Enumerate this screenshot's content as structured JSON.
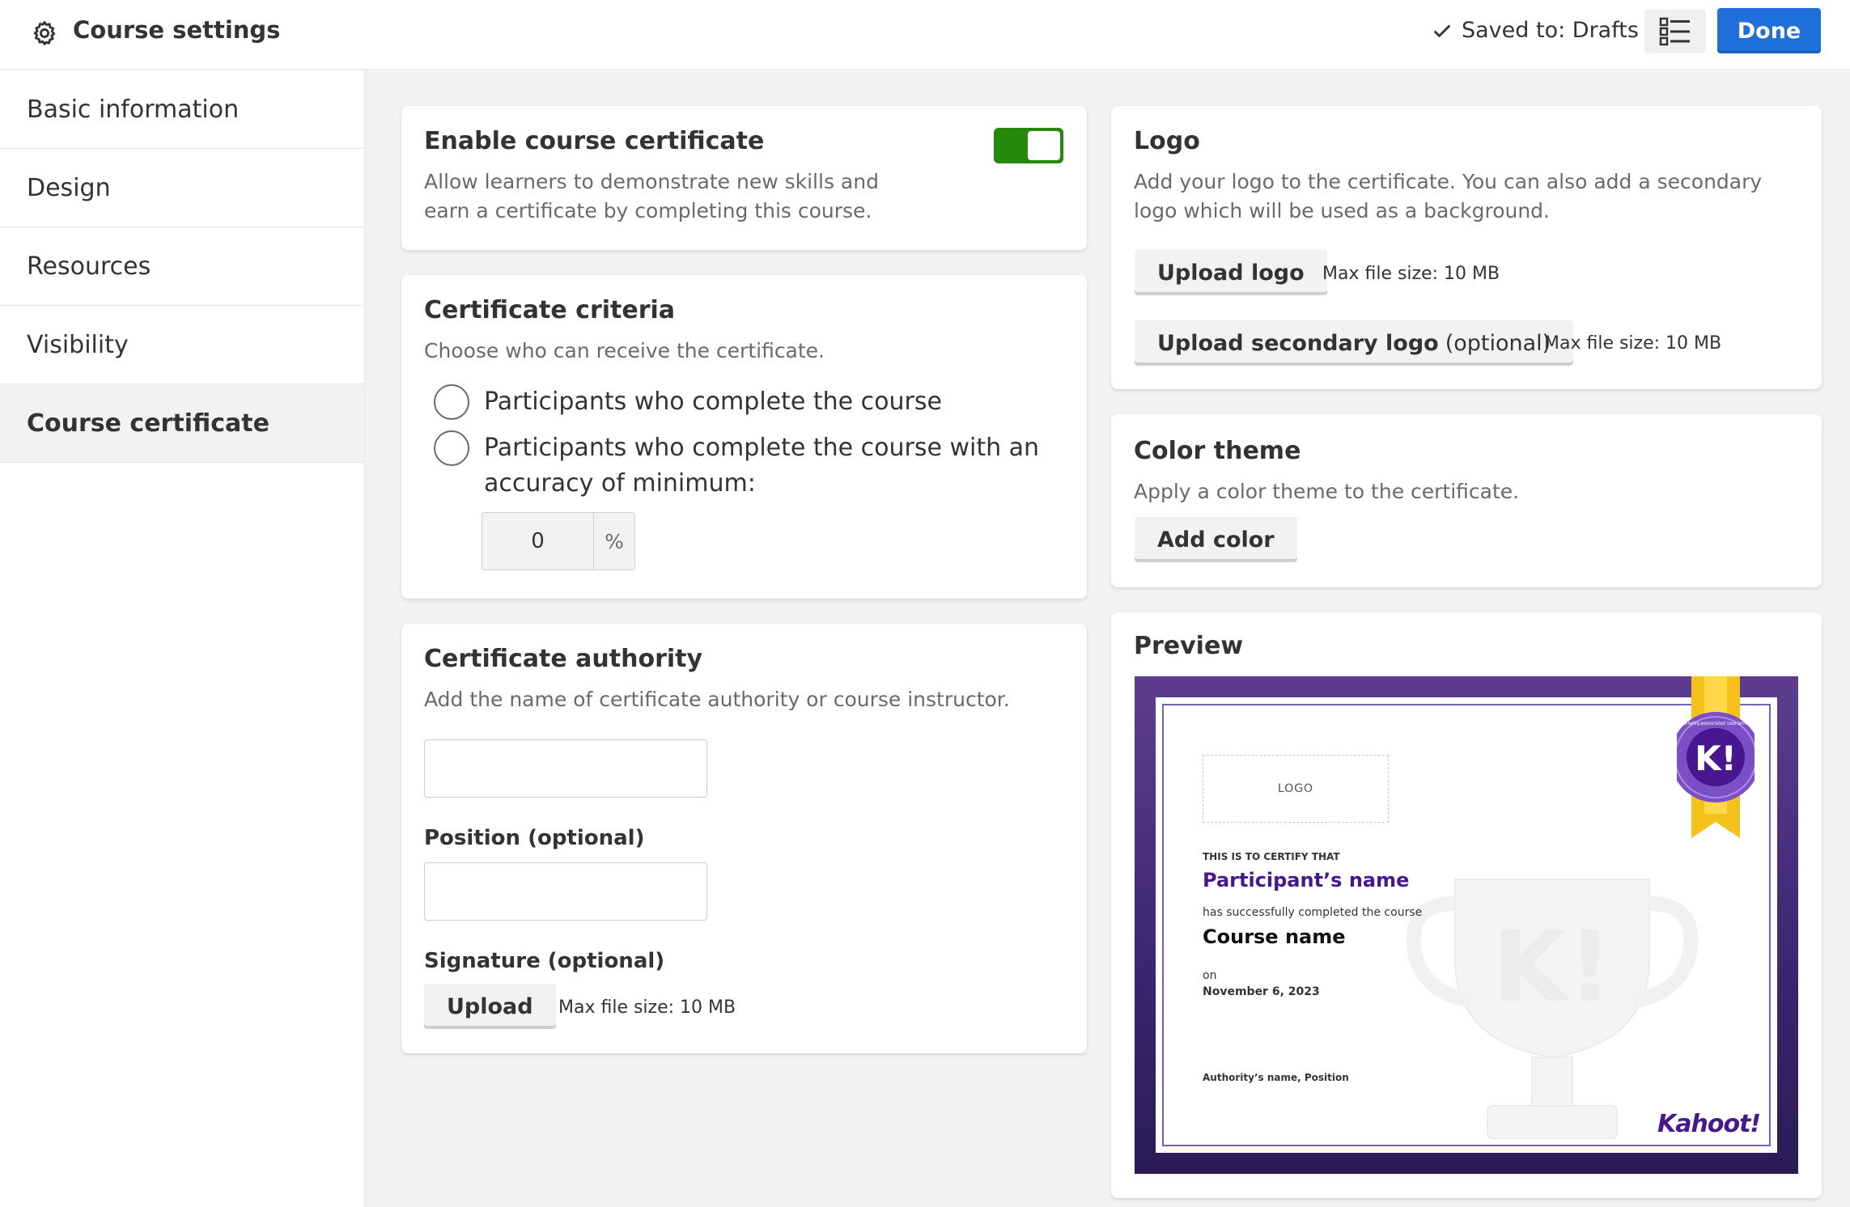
{
  "header": {
    "title": "Course settings",
    "saved_status": "Saved to: Drafts",
    "done_label": "Done"
  },
  "sidebar": {
    "items": [
      {
        "label": "Basic information",
        "active": false
      },
      {
        "label": "Design",
        "active": false
      },
      {
        "label": "Resources",
        "active": false
      },
      {
        "label": "Visibility",
        "active": false
      },
      {
        "label": "Course certificate",
        "active": true
      }
    ]
  },
  "enable_certificate": {
    "title": "Enable course certificate",
    "desc_line1": "Allow learners to demonstrate new skills and",
    "desc_line2": "earn a certificate by completing this course.",
    "enabled": true,
    "toggle_color": "#26890c"
  },
  "criteria": {
    "title": "Certificate criteria",
    "desc": "Choose who can receive the certificate.",
    "option1": "Participants who complete the course",
    "option2_line1": "Participants who complete the course with an",
    "option2_line2": "accuracy of minimum:",
    "accuracy_value": "0",
    "accuracy_unit": "%"
  },
  "authority": {
    "title": "Certificate authority",
    "desc": "Add the name of certificate authority or course instructor.",
    "name_value": "",
    "position_label": "Position (optional)",
    "position_value": "",
    "signature_label": "Signature (optional)",
    "upload_label": "Upload",
    "max_size": "Max file size: 10 MB"
  },
  "logo": {
    "title": "Logo",
    "desc_line1": "Add your logo to the certificate. You can also add a secondary",
    "desc_line2": "logo which will be used as a background.",
    "upload_logo_label": "Upload logo",
    "upload_logo_max": "Max file size: 10 MB",
    "upload_secondary_label": "Upload secondary logo",
    "upload_secondary_optional": "(optional)",
    "upload_secondary_max": "Max file size: 10 MB"
  },
  "color_theme": {
    "title": "Color theme",
    "desc": "Apply a color theme to the certificate.",
    "add_color_label": "Add color"
  },
  "preview": {
    "title": "Preview",
    "logo_placeholder": "LOGO",
    "certify_text": "THIS IS TO CERTIFY THAT",
    "participant_name": "Participant’s name",
    "completed_text": "has successfully completed the course",
    "course_name": "Course name",
    "on_text": "on",
    "date": "November 6, 2023",
    "authority_text": "Authority’s name, Position",
    "brand": "Kahoot!",
    "badge_letter": "K!",
    "badge_ring_text": "Make learning awesome! Kahoot! Course Certificate",
    "brand_color": "#46178f"
  },
  "colors": {
    "primary": "#1e6fd9",
    "toggle_on": "#26890c",
    "cert_purple": "#46178f"
  }
}
